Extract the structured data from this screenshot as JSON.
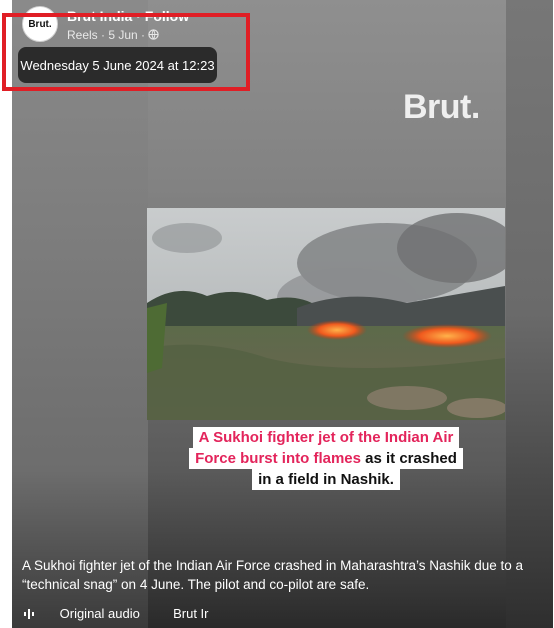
{
  "post": {
    "page_name": "Brut India · Follow",
    "avatar_text": "Brut.",
    "meta": "Reels · 5 Jun ·",
    "tooltip": "Wednesday 5 June 2024 at 12:23"
  },
  "video": {
    "watermark": "Brut.",
    "caption_pink_1": "A Sukhoi fighter jet of the Indian Air",
    "caption_pink_2": "Force burst into flames",
    "caption_black_2": " as it crashed",
    "caption_black_3": "in a field in Nashik."
  },
  "description": "A Sukhoi fighter jet of the Indian Air Force crashed in Maharashtra’s Nashik due to a “technical snag” on 4 June. The pilot and co-pilot are safe.",
  "footer": {
    "audio_label": "Original audio",
    "page_short": "Brut Ir"
  },
  "colors": {
    "highlight": "#e01e25",
    "caption_pink": "#e3245b"
  }
}
